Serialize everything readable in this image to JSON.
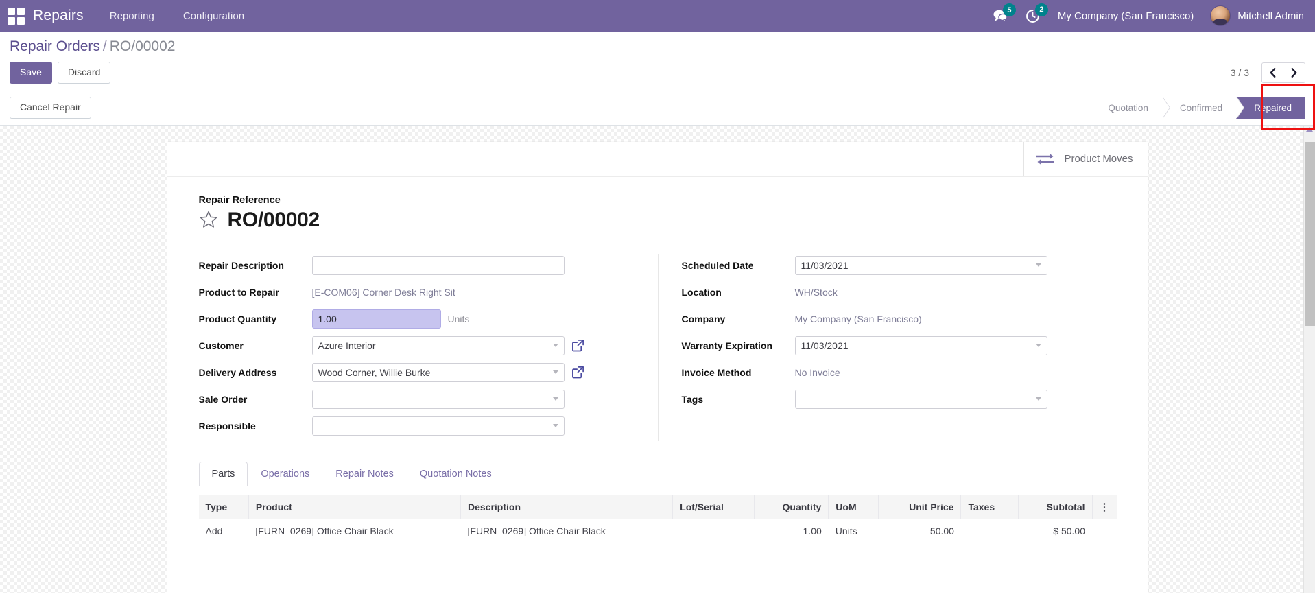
{
  "navbar": {
    "apps_icon": "apps-grid-icon",
    "brand": "Repairs",
    "menu": [
      {
        "label": "Reporting"
      },
      {
        "label": "Configuration"
      }
    ],
    "messages_icon": "messages-icon",
    "messages_count": "5",
    "activities_icon": "activity-clock-icon",
    "activities_count": "2",
    "company": "My Company (San Francisco)",
    "user": "Mitchell Admin",
    "accent_color": "#71639e",
    "badge_color": "#00828c"
  },
  "control_panel": {
    "breadcrumb_root": "Repair Orders",
    "breadcrumb_separator": "/",
    "breadcrumb_current": "RO/00002",
    "save_label": "Save",
    "discard_label": "Discard",
    "pager_value": "3 / 3",
    "prev_icon": "chevron-left-icon",
    "next_icon": "chevron-right-icon"
  },
  "statusbar": {
    "cancel_button": "Cancel Repair",
    "stages": [
      {
        "label": "Quotation",
        "active": false
      },
      {
        "label": "Confirmed",
        "active": false
      },
      {
        "label": "Repaired",
        "active": true
      }
    ],
    "highlight_color": "#ee1111"
  },
  "sheet": {
    "smart_button": {
      "icon": "exchange-arrows-icon",
      "label": "Product Moves"
    },
    "title_label": "Repair Reference",
    "star_icon": "star-outline-icon",
    "record_title": "RO/00002",
    "left_fields": [
      {
        "label": "Repair Description",
        "type": "input",
        "value": "",
        "placeholder": ""
      },
      {
        "label": "Product to Repair",
        "type": "readonly",
        "value": "[E-COM06] Corner Desk Right Sit"
      },
      {
        "label": "Product Quantity",
        "type": "input-selected",
        "value": "1.00",
        "suffix": "Units"
      },
      {
        "label": "Customer",
        "type": "select-link",
        "value": "Azure Interior",
        "link_icon": "external-link-icon"
      },
      {
        "label": "Delivery Address",
        "type": "select-link",
        "value": "Wood Corner, Willie Burke",
        "link_icon": "external-link-icon"
      },
      {
        "label": "Sale Order",
        "type": "select",
        "value": ""
      },
      {
        "label": "Responsible",
        "type": "select",
        "value": ""
      }
    ],
    "right_fields": [
      {
        "label": "Scheduled Date",
        "type": "select",
        "value": "11/03/2021"
      },
      {
        "label": "Location",
        "type": "readonly",
        "value": "WH/Stock"
      },
      {
        "label": "Company",
        "type": "readonly",
        "value": "My Company (San Francisco)"
      },
      {
        "label": "Warranty Expiration",
        "type": "select",
        "value": "11/03/2021"
      },
      {
        "label": "Invoice Method",
        "type": "readonly",
        "value": "No Invoice"
      },
      {
        "label": "Tags",
        "type": "select",
        "value": ""
      }
    ],
    "tabs": [
      {
        "label": "Parts",
        "active": true
      },
      {
        "label": "Operations",
        "active": false
      },
      {
        "label": "Repair Notes",
        "active": false
      },
      {
        "label": "Quotation Notes",
        "active": false
      }
    ],
    "table": {
      "columns": [
        {
          "label": "Type",
          "align": "left"
        },
        {
          "label": "Product",
          "align": "left"
        },
        {
          "label": "Description",
          "align": "left"
        },
        {
          "label": "Lot/Serial",
          "align": "left"
        },
        {
          "label": "Quantity",
          "align": "right"
        },
        {
          "label": "UoM",
          "align": "left"
        },
        {
          "label": "Unit Price",
          "align": "right"
        },
        {
          "label": "Taxes",
          "align": "left"
        },
        {
          "label": "Subtotal",
          "align": "right"
        }
      ],
      "optional_columns_icon": "vertical-dots-icon",
      "rows": [
        {
          "type": "Add",
          "product": "[FURN_0269] Office Chair Black",
          "description": "[FURN_0269] Office Chair Black",
          "lot_serial": "",
          "quantity": "1.00",
          "uom": "Units",
          "unit_price": "50.00",
          "taxes": "",
          "subtotal": "$ 50.00"
        }
      ]
    }
  }
}
